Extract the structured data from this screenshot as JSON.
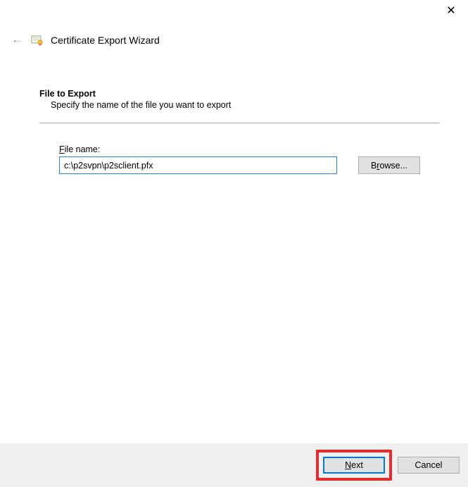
{
  "titlebar": {
    "close_glyph": "✕"
  },
  "header": {
    "back_arrow": "←",
    "wizard_title": "Certificate Export Wizard"
  },
  "content": {
    "heading": "File to Export",
    "subheading": "Specify the name of the file you want to export",
    "file_label_prefix_underlined": "F",
    "file_label_rest": "ile name:",
    "file_value": "c:\\p2svpn\\p2sclient.pfx",
    "browse_prefix": "B",
    "browse_underlined": "r",
    "browse_suffix": "owse..."
  },
  "footer": {
    "next_underlined": "N",
    "next_rest": "ext",
    "cancel": "Cancel"
  }
}
